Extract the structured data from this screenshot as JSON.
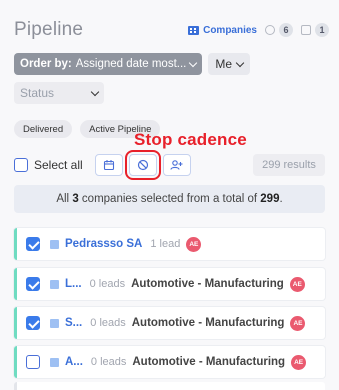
{
  "header": {
    "title": "Pipeline",
    "tabs": [
      {
        "label": "Companies",
        "icon": "building-icon",
        "active": true
      },
      {
        "label": "",
        "icon": "person-icon",
        "count": "6"
      },
      {
        "label": "",
        "icon": "box-icon",
        "count": "1"
      }
    ]
  },
  "filters": {
    "order_by_prefix": "Order by:",
    "order_by_value": "Assigned date most...",
    "owner": "Me",
    "status_placeholder": "Status"
  },
  "chips": [
    "Delivered",
    "Active Pipeline"
  ],
  "annotation": "Stop cadence",
  "toolbar": {
    "select_all": "Select all",
    "results": "299 results"
  },
  "banner": {
    "prefix": "All",
    "selected": "3",
    "middle": "companies selected from a total of",
    "total": "299",
    "suffix": "."
  },
  "rows": [
    {
      "company": "Pedrassso SA",
      "leads": "1 lead",
      "industry": "",
      "avatar": "AE",
      "checked": true
    },
    {
      "company": "L...",
      "leads": "0 leads",
      "industry": "Automotive - Manufacturing",
      "avatar": "AE",
      "checked": true
    },
    {
      "company": "S...",
      "leads": "0 leads",
      "industry": "Automotive - Manufacturing",
      "avatar": "AE",
      "checked": true
    },
    {
      "company": "A...",
      "leads": "0 leads",
      "industry": "Automotive - Manufacturing",
      "avatar": "AE",
      "checked": false
    }
  ],
  "colors": {
    "accent": "#3a6fd8",
    "annotation": "#e8202a",
    "row_border": "#6fdcc1",
    "avatar": "#ea5a6f"
  }
}
